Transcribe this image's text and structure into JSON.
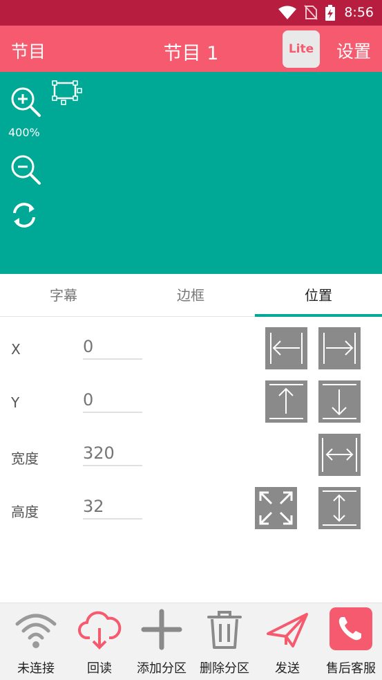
{
  "status_bar": {
    "time": "8:56"
  },
  "app_bar": {
    "left_label": "节目",
    "title": "节目 1",
    "lite_badge": "Lite",
    "settings_label": "设置"
  },
  "preview": {
    "zoom_level": "400%"
  },
  "tabs": [
    {
      "label": "字幕",
      "active": false
    },
    {
      "label": "边框",
      "active": false
    },
    {
      "label": "位置",
      "active": true
    }
  ],
  "form": {
    "x": {
      "label": "X",
      "placeholder": "0"
    },
    "y": {
      "label": "Y",
      "placeholder": "0"
    },
    "width": {
      "label": "宽度",
      "placeholder": "320"
    },
    "height": {
      "label": "高度",
      "placeholder": "32"
    }
  },
  "bottom_nav": [
    {
      "label": "未连接",
      "icon": "wifi-icon"
    },
    {
      "label": "回读",
      "icon": "cloud-download-icon"
    },
    {
      "label": "添加分区",
      "icon": "plus-icon"
    },
    {
      "label": "删除分区",
      "icon": "trash-icon"
    },
    {
      "label": "发送",
      "icon": "send-icon"
    },
    {
      "label": "售后客服",
      "icon": "phone-icon"
    }
  ],
  "colors": {
    "status_bar": "#b71d3e",
    "app_bar": "#f55a6e",
    "preview_bg": "#00a896",
    "tab_indicator": "#00a896",
    "align_button": "#8a8a8a",
    "accent_red": "#f55a6e"
  }
}
